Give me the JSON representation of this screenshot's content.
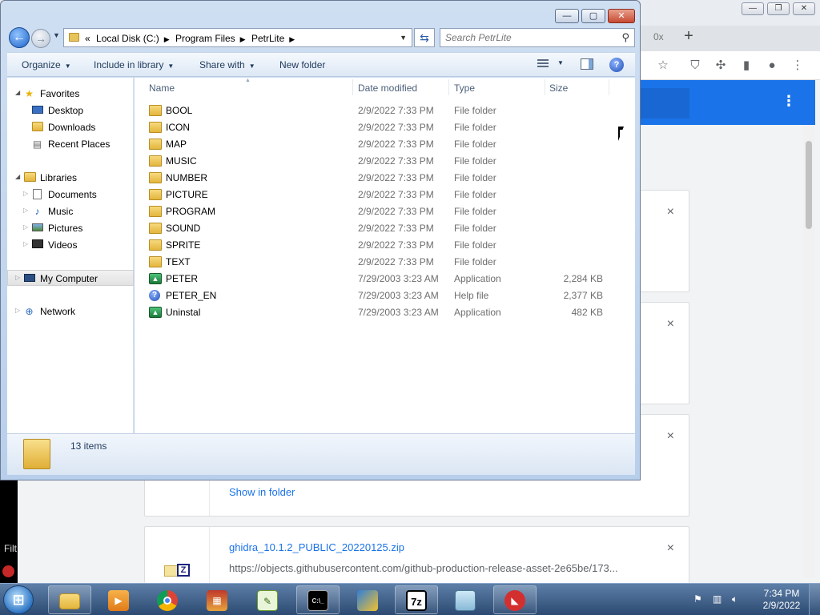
{
  "chrome": {
    "tab_count": "0x",
    "new_tab_glyph": "+",
    "toolbar_icons": [
      "star-icon",
      "ublock-icon",
      "puzzle-icon",
      "sidepanel-icon",
      "profile-icon",
      "menu-icon"
    ],
    "downloads": [
      {
        "title": "",
        "url": ""
      },
      {
        "title": "",
        "url": ""
      },
      {
        "title": "",
        "url": "",
        "action": "Show in folder"
      },
      {
        "title": "ghidra_10.1.2_PUBLIC_20220125.zip",
        "url": "https://objects.githubusercontent.com/github-production-release-asset-2e65be/173..."
      }
    ],
    "close_glyph": "×",
    "left_strip_text": "Filt"
  },
  "explorer": {
    "address": {
      "overflow": "«",
      "crumbs": [
        "Local Disk (C:)",
        "Program Files",
        "PetrLite"
      ]
    },
    "search_placeholder": "Search PetrLite",
    "commands": {
      "organize": "Organize",
      "include": "Include in library",
      "share": "Share with",
      "new_folder": "New folder"
    },
    "nav": {
      "favorites": "Favorites",
      "desktop": "Desktop",
      "downloads": "Downloads",
      "recent": "Recent Places",
      "libraries": "Libraries",
      "documents": "Documents",
      "music": "Music",
      "pictures": "Pictures",
      "videos": "Videos",
      "computer": "My Computer",
      "network": "Network"
    },
    "columns": {
      "name": "Name",
      "date": "Date modified",
      "type": "Type",
      "size": "Size"
    },
    "files": [
      {
        "name": "BOOL",
        "date": "2/9/2022 7:33 PM",
        "type": "File folder",
        "size": "",
        "icon": "folder-icon"
      },
      {
        "name": "ICON",
        "date": "2/9/2022 7:33 PM",
        "type": "File folder",
        "size": "",
        "icon": "folder-icon"
      },
      {
        "name": "MAP",
        "date": "2/9/2022 7:33 PM",
        "type": "File folder",
        "size": "",
        "icon": "folder-icon"
      },
      {
        "name": "MUSIC",
        "date": "2/9/2022 7:33 PM",
        "type": "File folder",
        "size": "",
        "icon": "folder-icon"
      },
      {
        "name": "NUMBER",
        "date": "2/9/2022 7:33 PM",
        "type": "File folder",
        "size": "",
        "icon": "folder-icon"
      },
      {
        "name": "PICTURE",
        "date": "2/9/2022 7:33 PM",
        "type": "File folder",
        "size": "",
        "icon": "folder-icon"
      },
      {
        "name": "PROGRAM",
        "date": "2/9/2022 7:33 PM",
        "type": "File folder",
        "size": "",
        "icon": "folder-icon"
      },
      {
        "name": "SOUND",
        "date": "2/9/2022 7:33 PM",
        "type": "File folder",
        "size": "",
        "icon": "folder-icon"
      },
      {
        "name": "SPRITE",
        "date": "2/9/2022 7:33 PM",
        "type": "File folder",
        "size": "",
        "icon": "folder-icon"
      },
      {
        "name": "TEXT",
        "date": "2/9/2022 7:33 PM",
        "type": "File folder",
        "size": "",
        "icon": "folder-icon"
      },
      {
        "name": "PETER",
        "date": "7/29/2003 3:23 AM",
        "type": "Application",
        "size": "2,284 KB",
        "icon": "application-icon"
      },
      {
        "name": "PETER_EN",
        "date": "7/29/2003 3:23 AM",
        "type": "Help file",
        "size": "2,377 KB",
        "icon": "help-file-icon"
      },
      {
        "name": "Uninstal",
        "date": "7/29/2003 3:23 AM",
        "type": "Application",
        "size": "482 KB",
        "icon": "application-icon"
      }
    ],
    "status": "13 items"
  },
  "taskbar": {
    "apps": [
      "explorer-icon",
      "media-player-icon",
      "chrome-icon",
      "archive-tool-icon",
      "notepadpp-icon",
      "cmd-icon",
      "network-tool-icon",
      "7zip-icon",
      "notepad-icon",
      "petrlite-icon"
    ],
    "labels": {
      "cmd": "C:\\_",
      "sevenzip": "7z"
    },
    "time": "7:34 PM",
    "date": "2/9/2022"
  }
}
